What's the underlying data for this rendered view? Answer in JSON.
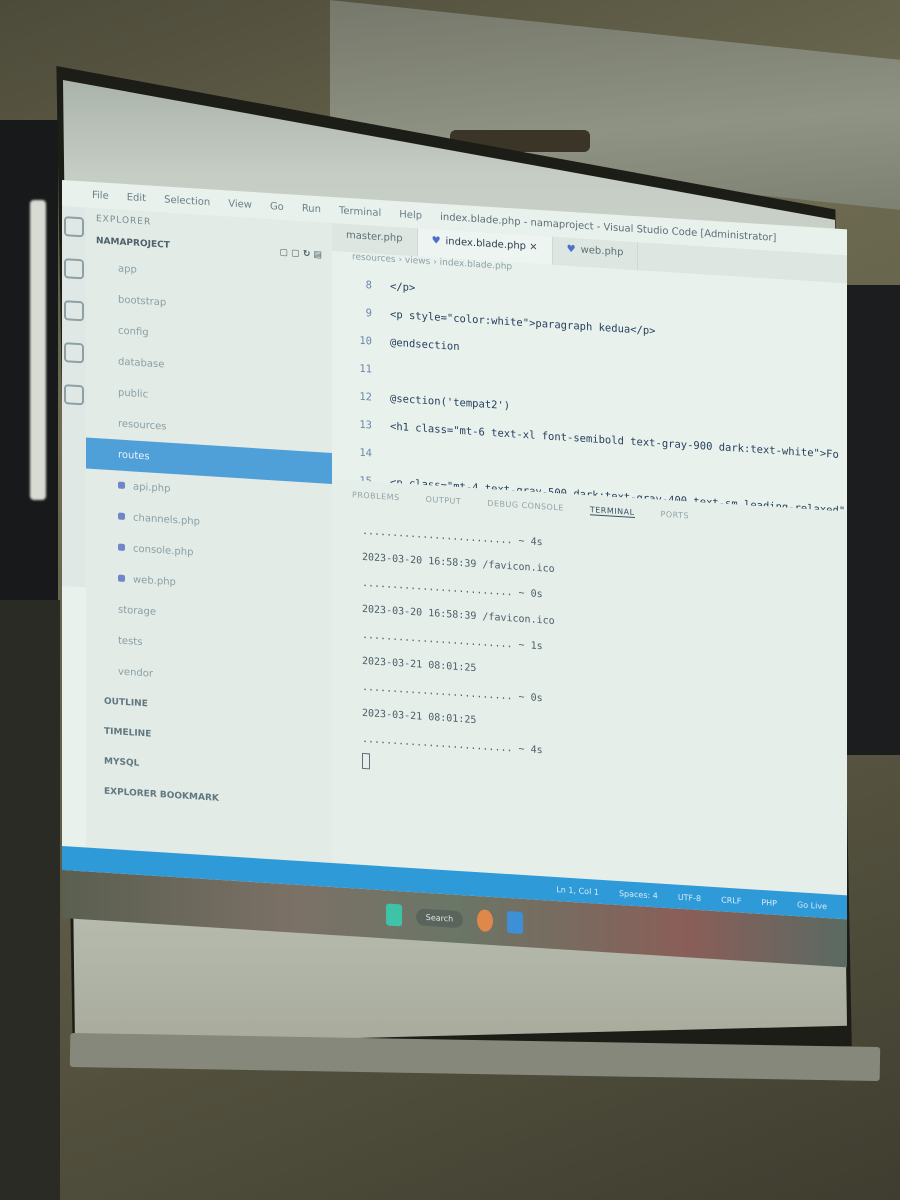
{
  "menubar": {
    "items": [
      "File",
      "Edit",
      "Selection",
      "View",
      "Go",
      "Run",
      "Terminal",
      "Help"
    ],
    "title": "index.blade.php - namaproject - Visual Studio Code [Administrator]"
  },
  "sidebar": {
    "header": "EXPLORER",
    "project": "NAMAPROJECT",
    "items": [
      {
        "label": "app",
        "selected": false,
        "icon": ""
      },
      {
        "label": "bootstrap",
        "selected": false,
        "icon": ""
      },
      {
        "label": "config",
        "selected": false,
        "icon": ""
      },
      {
        "label": "database",
        "selected": false,
        "icon": ""
      },
      {
        "label": "public",
        "selected": false,
        "icon": ""
      },
      {
        "label": "resources",
        "selected": false,
        "icon": ""
      },
      {
        "label": "routes",
        "selected": true,
        "icon": ""
      },
      {
        "label": "api.php",
        "selected": false,
        "icon": "php-file-icon"
      },
      {
        "label": "channels.php",
        "selected": false,
        "icon": "php-file-icon"
      },
      {
        "label": "console.php",
        "selected": false,
        "icon": "php-file-icon"
      },
      {
        "label": "web.php",
        "selected": false,
        "icon": "php-file-icon"
      },
      {
        "label": "storage",
        "selected": false,
        "icon": ""
      },
      {
        "label": "tests",
        "selected": false,
        "icon": ""
      },
      {
        "label": "vendor",
        "selected": false,
        "icon": ""
      }
    ],
    "sections": [
      "OUTLINE",
      "TIMELINE",
      "MYSQL",
      "EXPLORER BOOKMARK"
    ]
  },
  "tabs": [
    {
      "label": "master.php",
      "active": false
    },
    {
      "label": "index.blade.php",
      "active": true
    },
    {
      "label": "web.php",
      "active": false
    }
  ],
  "breadcrumb": "resources › views › index.blade.php",
  "editor": {
    "lines": [
      {
        "n": "8",
        "text": "</p>"
      },
      {
        "n": "9",
        "text": "<p style=\"color:white\">paragraph kedua</p>"
      },
      {
        "n": "10",
        "text": "@endsection"
      },
      {
        "n": "11",
        "text": ""
      },
      {
        "n": "12",
        "text": "@section('tempat2')"
      },
      {
        "n": "13",
        "text": "<h1 class=\"mt-6 text-xl font-semibold text-gray-900 dark:text-white\">Fo"
      },
      {
        "n": "14",
        "text": ""
      },
      {
        "n": "15",
        "text": "<p class=\"mt-4 text-gray-500 dark:text-gray-400 text-sm leading-relaxed\""
      }
    ]
  },
  "panel": {
    "tabs": [
      "PROBLEMS",
      "OUTPUT",
      "DEBUG CONSOLE",
      "TERMINAL",
      "PORTS"
    ],
    "active_tab": "TERMINAL",
    "terminal_lines": [
      "......................... ~ 4s",
      "2023-03-20 16:58:39 /favicon.ico",
      "......................... ~ 0s",
      "2023-03-20 16:58:39 /favicon.ico",
      "......................... ~ 1s",
      "2023-03-21 08:01:25",
      "......................... ~ 0s",
      "2023-03-21 08:01:25",
      "......................... ~ 4s"
    ]
  },
  "statusbar": {
    "items": [
      "Ln 1, Col 1",
      "Spaces: 4",
      "UTF-8",
      "CRLF",
      "PHP",
      "Go Live"
    ]
  },
  "taskbar": {
    "search_label": "Search"
  },
  "colors": {
    "statusbar": "#2f9ad8",
    "selection": "#4f9fd8"
  }
}
